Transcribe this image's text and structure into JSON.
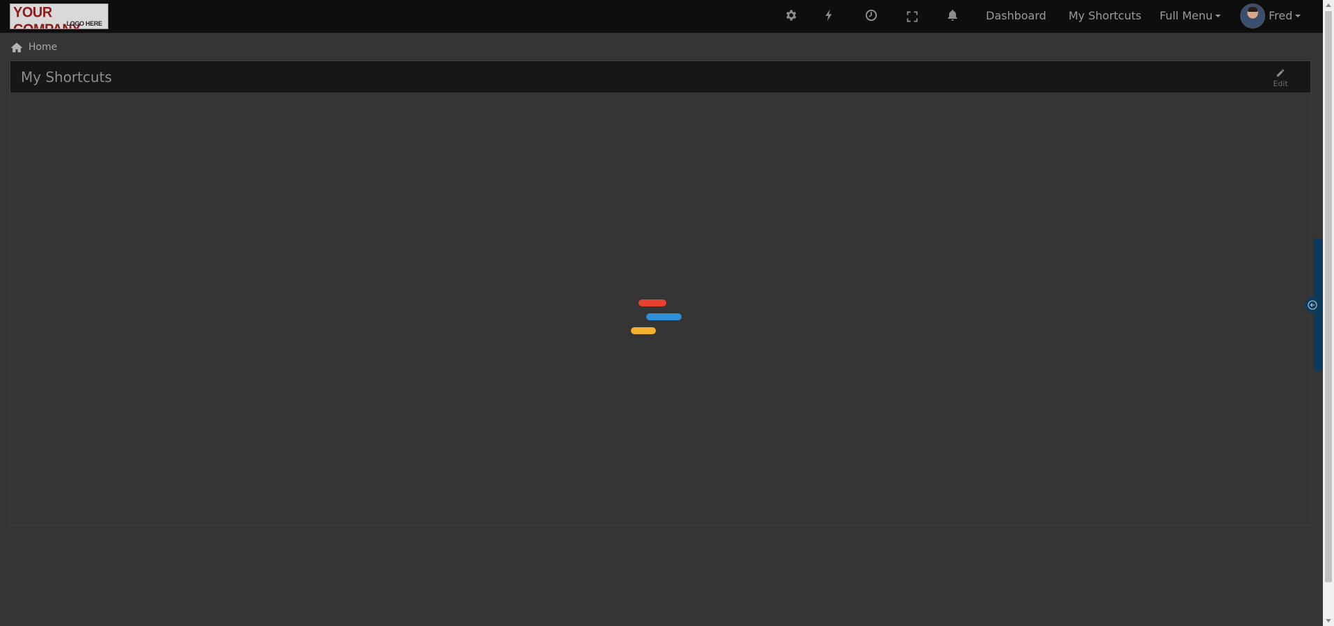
{
  "logo": {
    "line1": "YOUR COMPANY",
    "line2": "LOGO HERE"
  },
  "navbar": {
    "icons": [
      "gear-icon",
      "bolt-icon",
      "history-icon",
      "fullscreen-icon",
      "bell-icon"
    ],
    "links": {
      "dashboard": "Dashboard",
      "shortcuts": "My Shortcuts",
      "full_menu": "Full Menu"
    },
    "user": {
      "name": "Fred"
    }
  },
  "breadcrumb": {
    "home": "Home"
  },
  "panel": {
    "title": "My Shortcuts",
    "edit_label": "Edit"
  },
  "loader": {
    "colors": [
      "#e8412f",
      "#2f8fd8",
      "#f3b12e"
    ]
  },
  "colors": {
    "background": "#353535",
    "navbar": "#0e0e0e",
    "panel_header": "#161718",
    "side_tab": "#0b3a5c"
  }
}
